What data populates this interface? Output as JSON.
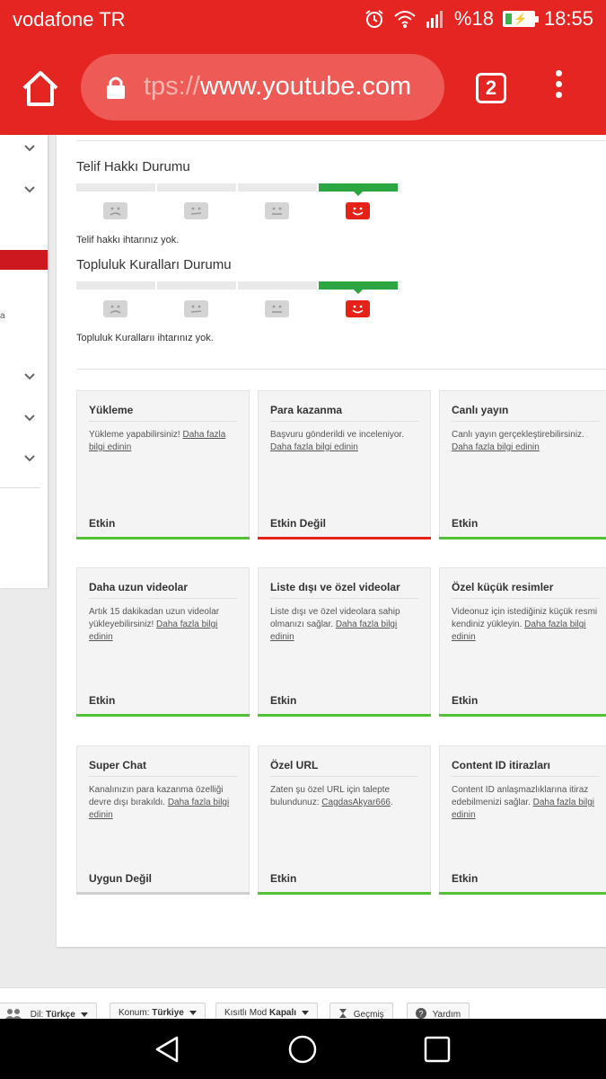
{
  "status_bar": {
    "carrier": "vodafone TR",
    "battery": "%18",
    "time": "18:55",
    "icons": [
      "alarm-icon",
      "wifi-icon",
      "signal-icon",
      "battery-icon"
    ]
  },
  "browser": {
    "url_scheme": "tps://",
    "url_host": "www.youtube.com",
    "tab_count": "2"
  },
  "copyright": {
    "title": "Telif Hakkı Durumu",
    "note": "Telif hakkı ihtarınız yok.",
    "level": 4,
    "levels_total": 4
  },
  "community": {
    "title": "Topluluk Kuralları Durumu",
    "note": "Topluluk Kurallarıı ihtarınız yok.",
    "level": 4,
    "levels_total": 4
  },
  "features": [
    {
      "title": "Yükleme",
      "desc": "Yükleme yapabilirsiniz!",
      "link": "Daha fazla bilgi edinin",
      "status": "Etkin",
      "state": "enabled"
    },
    {
      "title": "Para kazanma",
      "desc": "Başvuru gönderildi ve inceleniyor.",
      "link": "Daha fazla bilgi edinin",
      "status": "Etkin Değil",
      "state": "disabled"
    },
    {
      "title": "Canlı yayın",
      "desc": "Canlı yayın gerçekleştirebilirsiniz.",
      "link": "Daha fazla bilgi edinin",
      "status": "Etkin",
      "state": "enabled"
    },
    {
      "title": "Daha uzun videolar",
      "desc": "Artık 15 dakikadan uzun videolar yükleyebilirsiniz!",
      "link": "Daha fazla bilgi edinin",
      "status": "Etkin",
      "state": "enabled"
    },
    {
      "title": "Liste dışı ve özel videolar",
      "desc": "Liste dışı ve özel videolara sahip olmanızı sağlar.",
      "link": "Daha fazla bilgi edinin",
      "status": "Etkin",
      "state": "enabled"
    },
    {
      "title": "Özel küçük resimler",
      "desc": "Videonuz için istediğiniz küçük resmi kendiniz yükleyin.",
      "link": "Daha fazla bilgi edinin",
      "status": "Etkin",
      "state": "enabled"
    },
    {
      "title": "Super Chat",
      "desc": "Kanalınızın para kazanma özelliği devre dışı bırakıldı.",
      "link": "Daha fazla bilgi edinin",
      "status": "Uygun Değil",
      "state": "ineligible"
    },
    {
      "title": "Özel URL",
      "desc": "Zaten şu özel URL için talepte bulundunuz:",
      "link": "CagdasAkyar666",
      "suffix": ".",
      "status": "Etkin",
      "state": "enabled"
    },
    {
      "title": "Content ID itirazları",
      "desc": "Content ID anlaşmazlıklarına itiraz edebilmenizi sağlar.",
      "link": "Daha fazla bilgi edinin",
      "status": "Etkin",
      "state": "enabled"
    }
  ],
  "colors": {
    "brand": "#e52521",
    "enabled": "#52c234",
    "disabled": "#e62117",
    "ineligible": "#cfcfcf"
  },
  "footer": {
    "language_label": "Dil:",
    "language_value": "Türkçe",
    "location_label": "Konum:",
    "location_value": "Türkiye",
    "restricted_label": "Kısıtlı Mod",
    "restricted_value": "Kapalı",
    "history_label": "Geçmiş",
    "help_label": "Yardım"
  },
  "sidebar_fragment": "a"
}
